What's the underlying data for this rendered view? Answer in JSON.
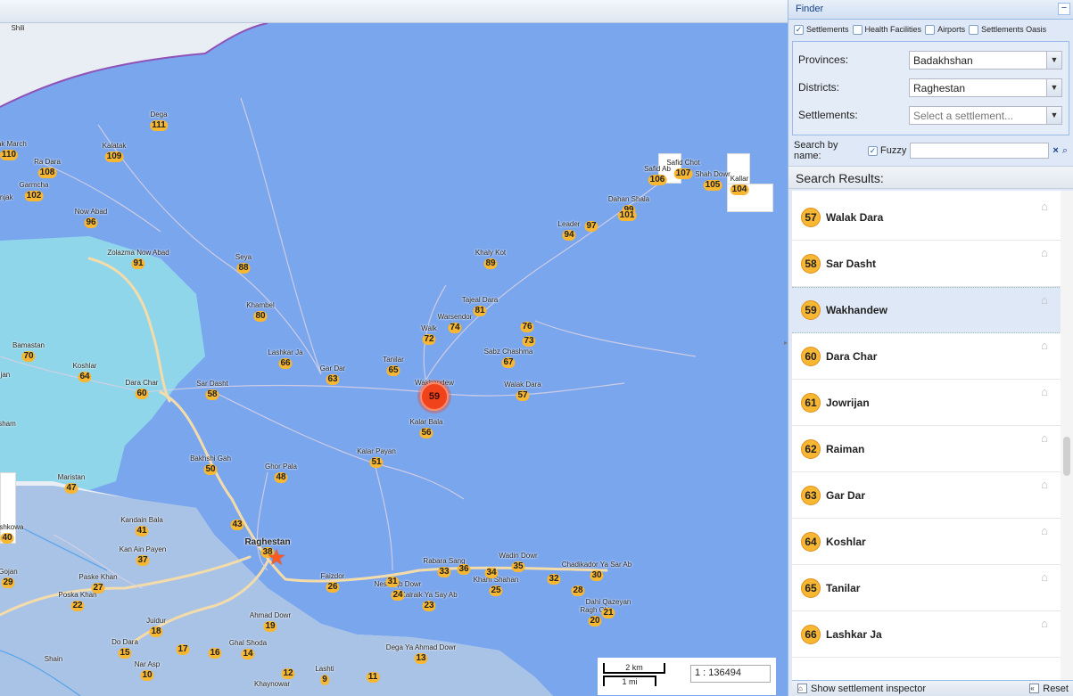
{
  "map": {
    "scale_km": "2 km",
    "scale_mi": "1 mi",
    "scale_ratio": "1 : 136494",
    "cluster_label": "59",
    "star_label": "39",
    "places": [
      {
        "name": "Dega",
        "num": "111"
      },
      {
        "name": "Kalatak",
        "num": "109"
      },
      {
        "name": "Ra Dara",
        "num": "108"
      },
      {
        "name": "Garmcha",
        "num": "102"
      },
      {
        "name": "htak March",
        "num": "110"
      },
      {
        "name": "anjak",
        "num": ""
      },
      {
        "name": "Now Abad",
        "num": "96"
      },
      {
        "name": "Zolazma Now Abad",
        "num": "91"
      },
      {
        "name": "Seya",
        "num": "88"
      },
      {
        "name": "Khambel",
        "num": "80"
      },
      {
        "name": "Lashkar Ja",
        "num": "66"
      },
      {
        "name": "Gar Dar",
        "num": "63"
      },
      {
        "name": "Tanilar",
        "num": "65"
      },
      {
        "name": "Walk",
        "num": "72"
      },
      {
        "name": "Warsendor",
        "num": "74"
      },
      {
        "name": "Tajeal Dara",
        "num": "81"
      },
      {
        "name": "Khaly Kot",
        "num": "89"
      },
      {
        "name": "Leader",
        "num": "94"
      },
      {
        "name": "",
        "num": "97"
      },
      {
        "name": "Dahan Shala",
        "num": "99"
      },
      {
        "name": "Safid Ab",
        "num": "106"
      },
      {
        "name": "Safid Chot",
        "num": "107"
      },
      {
        "name": "Shah Dowr",
        "num": "105"
      },
      {
        "name": "Kallar",
        "num": "104"
      },
      {
        "name": "",
        "num": "101"
      },
      {
        "name": "",
        "num": "76"
      },
      {
        "name": "",
        "num": "73"
      },
      {
        "name": "Sabz Chashma",
        "num": "67"
      },
      {
        "name": "Walak Dara",
        "num": "57"
      },
      {
        "name": "Wakhandew",
        "num": ""
      },
      {
        "name": "Kalar Bala",
        "num": "56"
      },
      {
        "name": "Kalar Payan",
        "num": "51"
      },
      {
        "name": "Ghor Pala",
        "num": "48"
      },
      {
        "name": "Bakhshi Gah",
        "num": "50"
      },
      {
        "name": "Sar Dasht",
        "num": "58"
      },
      {
        "name": "Dara Char",
        "num": "60"
      },
      {
        "name": "Koshlar",
        "num": "64"
      },
      {
        "name": "Bamastan",
        "num": "70"
      },
      {
        "name": "Maristan",
        "num": "47"
      },
      {
        "name": "ijan",
        "num": ""
      },
      {
        "name": "sham",
        "num": ""
      },
      {
        "name": "",
        "num": "43"
      },
      {
        "name": "Kandain Bala",
        "num": "41"
      },
      {
        "name": "Kan Ain Payen",
        "num": "37"
      },
      {
        "name": "Raghestan",
        "num": "38"
      },
      {
        "name": "Pashkowa",
        "num": "40"
      },
      {
        "name": "Gojan",
        "num": "29"
      },
      {
        "name": "Paske Khan",
        "num": "27"
      },
      {
        "name": "Poska Khan",
        "num": "22"
      },
      {
        "name": "Faizdor",
        "num": "26"
      },
      {
        "name": "",
        "num": "31"
      },
      {
        "name": "Neshaqb Dowr",
        "num": "24"
      },
      {
        "name": "Kalraik Ya Say Ab",
        "num": "23"
      },
      {
        "name": "Rabara Sang",
        "num": "33"
      },
      {
        "name": "",
        "num": "36"
      },
      {
        "name": "",
        "num": "34"
      },
      {
        "name": "Wadin Dowr",
        "num": "35"
      },
      {
        "name": "Kham Shahan",
        "num": "25"
      },
      {
        "name": "",
        "num": "32"
      },
      {
        "name": "Chadikador Ya Sar Ab",
        "num": "30"
      },
      {
        "name": "",
        "num": "28"
      },
      {
        "name": "Dahi Qazeyan",
        "num": "21"
      },
      {
        "name": "Ragh Chi",
        "num": "20"
      },
      {
        "name": "Juidur",
        "num": "18"
      },
      {
        "name": "Ahmad Dowr",
        "num": "19"
      },
      {
        "name": "",
        "num": "17"
      },
      {
        "name": "",
        "num": "16"
      },
      {
        "name": "Ghal Shoda",
        "num": "14"
      },
      {
        "name": "Do Dara",
        "num": "15"
      },
      {
        "name": "Nar Asp",
        "num": "10"
      },
      {
        "name": "",
        "num": "12"
      },
      {
        "name": "Lashti",
        "num": "9"
      },
      {
        "name": "",
        "num": "11"
      },
      {
        "name": "Dega Ya Ahmad Dowr",
        "num": "13"
      },
      {
        "name": "Khaynowar",
        "num": ""
      },
      {
        "name": "Shain",
        "num": ""
      },
      {
        "name": "Shili",
        "num": ""
      }
    ]
  },
  "panel": {
    "title": "Finder",
    "collapse_glyph": "−",
    "layers": [
      {
        "label": "Settlements",
        "checked": true
      },
      {
        "label": "Health Facilities",
        "checked": false
      },
      {
        "label": "Airports",
        "checked": false
      },
      {
        "label": "Settlements Oasis",
        "checked": false
      }
    ],
    "filters": {
      "provinces_label": "Provinces:",
      "provinces_value": "Badakhshan",
      "districts_label": "Districts:",
      "districts_value": "Raghestan",
      "settlements_label": "Settlements:",
      "settlements_placeholder": "Select a settlement..."
    },
    "search": {
      "label": "Search by name:",
      "fuzzy_label": "Fuzzy",
      "fuzzy_checked": true,
      "value": "",
      "clear_glyph": "×"
    },
    "results_title": "Search Results:",
    "results": [
      {
        "num": "57",
        "name": "Walak Dara",
        "selected": false
      },
      {
        "num": "58",
        "name": "Sar Dasht",
        "selected": false
      },
      {
        "num": "59",
        "name": "Wakhandew",
        "selected": true
      },
      {
        "num": "60",
        "name": "Dara Char",
        "selected": false
      },
      {
        "num": "61",
        "name": "Jowrijan",
        "selected": false
      },
      {
        "num": "62",
        "name": "Raiman",
        "selected": false
      },
      {
        "num": "63",
        "name": "Gar Dar",
        "selected": false
      },
      {
        "num": "64",
        "name": "Koshlar",
        "selected": false
      },
      {
        "num": "65",
        "name": "Tanilar",
        "selected": false
      },
      {
        "num": "66",
        "name": "Lashkar Ja",
        "selected": false
      }
    ],
    "footer": {
      "inspector_label": "Show settlement inspector",
      "reset_label": "Reset"
    }
  }
}
